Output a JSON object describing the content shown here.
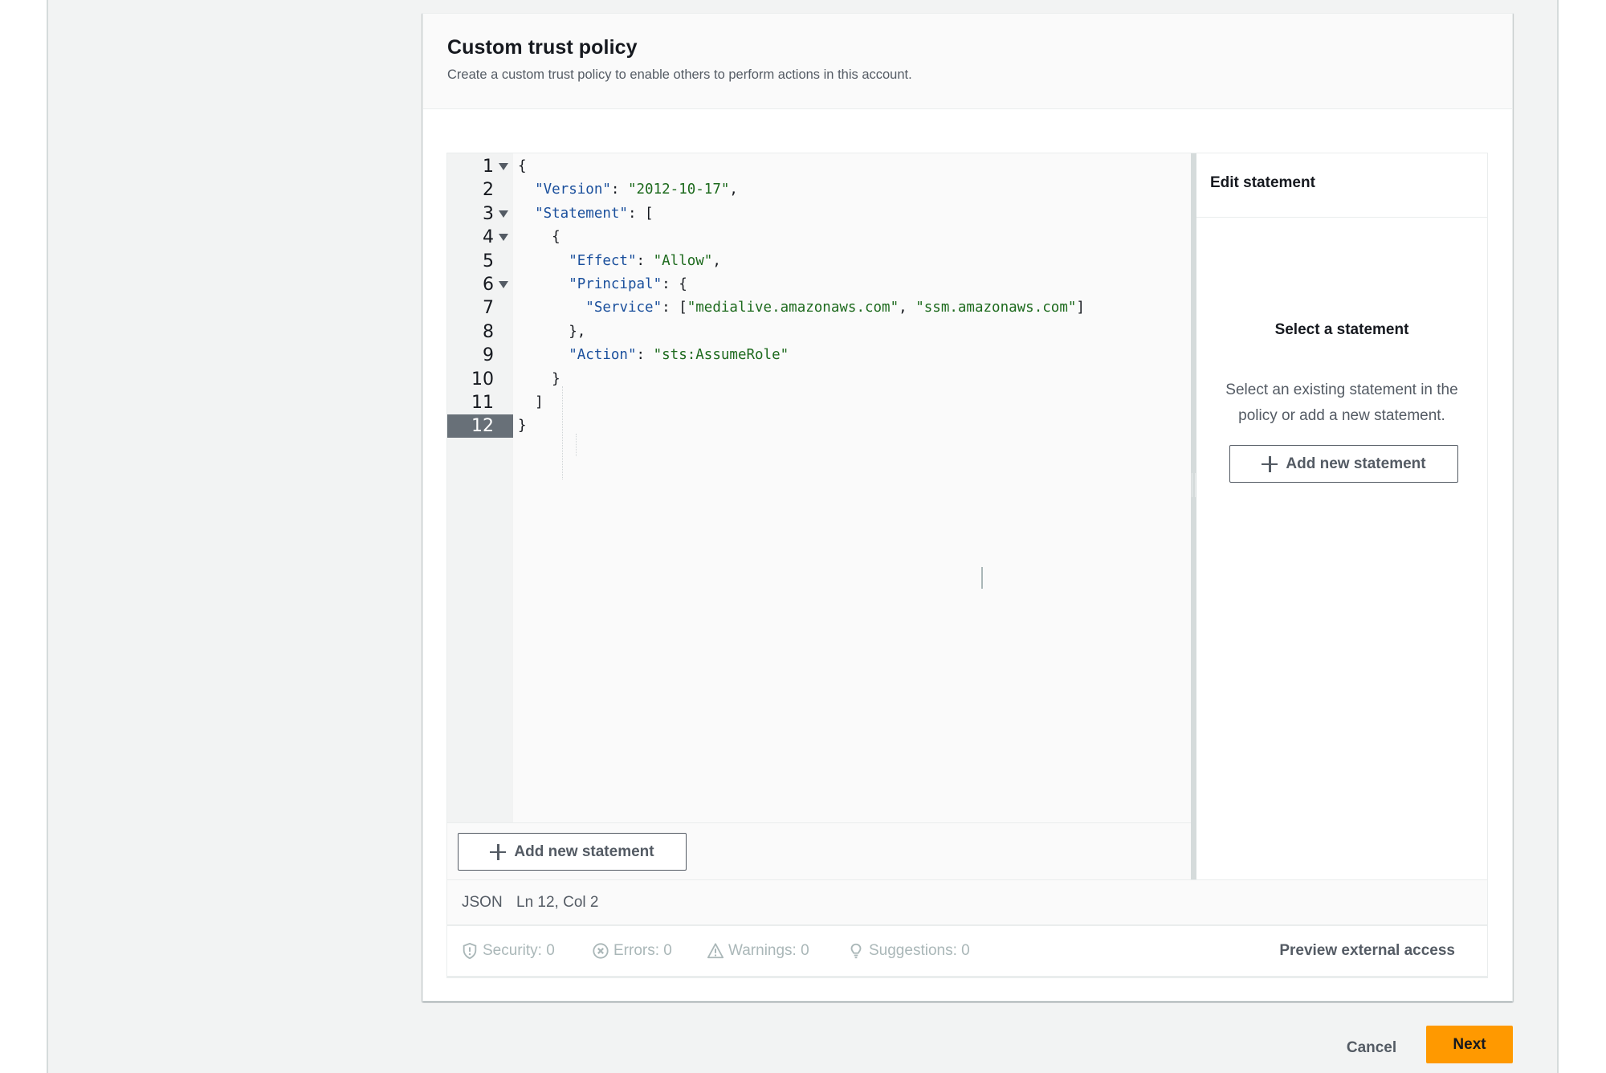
{
  "card": {
    "title": "Custom trust policy",
    "description": "Create a custom trust policy to enable others to perform actions in this account."
  },
  "editor": {
    "lines": [
      {
        "num": "1",
        "foldable": true,
        "tokens": [
          {
            "t": "p",
            "v": "{"
          }
        ]
      },
      {
        "num": "2",
        "foldable": false,
        "tokens": [
          {
            "t": "p",
            "v": "  "
          },
          {
            "t": "k",
            "v": "\"Version\""
          },
          {
            "t": "p",
            "v": ": "
          },
          {
            "t": "s",
            "v": "\"2012-10-17\""
          },
          {
            "t": "p",
            "v": ","
          }
        ]
      },
      {
        "num": "3",
        "foldable": true,
        "tokens": [
          {
            "t": "p",
            "v": "  "
          },
          {
            "t": "k",
            "v": "\"Statement\""
          },
          {
            "t": "p",
            "v": ": ["
          }
        ]
      },
      {
        "num": "4",
        "foldable": true,
        "tokens": [
          {
            "t": "p",
            "v": "    {"
          }
        ]
      },
      {
        "num": "5",
        "foldable": false,
        "tokens": [
          {
            "t": "p",
            "v": "      "
          },
          {
            "t": "k",
            "v": "\"Effect\""
          },
          {
            "t": "p",
            "v": ": "
          },
          {
            "t": "s",
            "v": "\"Allow\""
          },
          {
            "t": "p",
            "v": ","
          }
        ]
      },
      {
        "num": "6",
        "foldable": true,
        "tokens": [
          {
            "t": "p",
            "v": "      "
          },
          {
            "t": "k",
            "v": "\"Principal\""
          },
          {
            "t": "p",
            "v": ": {"
          }
        ]
      },
      {
        "num": "7",
        "foldable": false,
        "tokens": [
          {
            "t": "p",
            "v": "        "
          },
          {
            "t": "k",
            "v": "\"Service\""
          },
          {
            "t": "p",
            "v": ": ["
          },
          {
            "t": "s",
            "v": "\"medialive.amazonaws.com\""
          },
          {
            "t": "p",
            "v": ", "
          },
          {
            "t": "s",
            "v": "\"ssm.amazonaws.com\""
          },
          {
            "t": "p",
            "v": "]"
          }
        ]
      },
      {
        "num": "8",
        "foldable": false,
        "tokens": [
          {
            "t": "p",
            "v": "      },"
          }
        ]
      },
      {
        "num": "9",
        "foldable": false,
        "tokens": [
          {
            "t": "p",
            "v": "      "
          },
          {
            "t": "k",
            "v": "\"Action\""
          },
          {
            "t": "p",
            "v": ": "
          },
          {
            "t": "s",
            "v": "\"sts:AssumeRole\""
          }
        ]
      },
      {
        "num": "10",
        "foldable": false,
        "tokens": [
          {
            "t": "p",
            "v": "    }"
          }
        ]
      },
      {
        "num": "11",
        "foldable": false,
        "tokens": [
          {
            "t": "p",
            "v": "  ]"
          }
        ]
      },
      {
        "num": "12",
        "foldable": false,
        "active": true,
        "tokens": [
          {
            "t": "p",
            "v": "}"
          }
        ]
      }
    ],
    "add_statement_label": "Add new statement",
    "status": {
      "mode": "JSON",
      "position": "Ln 12, Col 2"
    },
    "checks": [
      {
        "icon": "shield-icon",
        "label": "Security: 0"
      },
      {
        "icon": "error-icon",
        "label": "Errors: 0"
      },
      {
        "icon": "warning-icon",
        "label": "Warnings: 0"
      },
      {
        "icon": "lightbulb-icon",
        "label": "Suggestions: 0"
      }
    ],
    "preview_label": "Preview external access"
  },
  "side_panel": {
    "title": "Edit statement",
    "empty_title": "Select a statement",
    "empty_description": "Select an existing statement in the policy or add a new statement.",
    "add_statement_label": "Add new statement"
  },
  "actions": {
    "cancel_label": "Cancel",
    "next_label": "Next"
  },
  "colors": {
    "primary_button": "#ff9900",
    "json_key": "#1a4f9c",
    "json_string": "#1d6a1d"
  }
}
